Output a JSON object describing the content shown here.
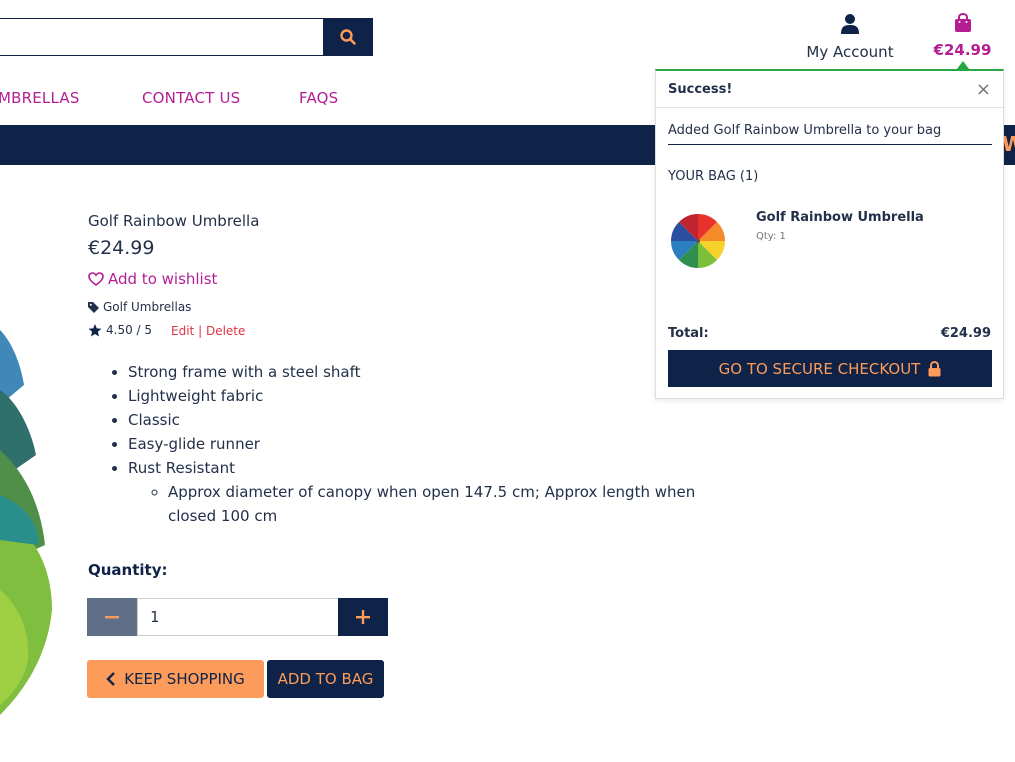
{
  "header": {
    "account_label": "My Account",
    "bag_total": "€24.99"
  },
  "nav": {
    "items": [
      "MBRELLAS",
      "CONTACT US",
      "FAQS"
    ]
  },
  "banner": {
    "text": "WE"
  },
  "product": {
    "name": "Golf Rainbow Umbrella",
    "price": "€24.99",
    "wishlist_label": "Add to wishlist",
    "category": "Golf Umbrellas",
    "rating": "4.50 / 5",
    "edit_label": "Edit",
    "separator": "|",
    "delete_label": "Delete",
    "features": [
      "Strong frame with a steel shaft",
      "Lightweight fabric",
      "Classic",
      "Easy-glide runner",
      "Rust Resistant"
    ],
    "sub_feature": "Approx diameter of canopy when open 147.5 cm; Approx length when closed 100 cm"
  },
  "quantity": {
    "label": "Quantity:",
    "value": "1"
  },
  "buttons": {
    "keep_shopping": "KEEP SHOPPING",
    "add_to_bag": "ADD TO BAG"
  },
  "toast": {
    "title": "Success!",
    "close": "×",
    "message": "Added Golf Rainbow Umbrella to your bag",
    "bag_label": "YOUR BAG (1)",
    "item_name": "Golf Rainbow Umbrella",
    "item_qty": "Qty: 1",
    "total_label": "Total:",
    "total_value": "€24.99",
    "checkout_label": "GO TO SECURE CHECKOUT"
  },
  "colors": {
    "navy": "#0e2347",
    "magenta": "#b31f93",
    "orange": "#fd9b5a",
    "success_green": "#28a745"
  },
  "icons": [
    "search-icon",
    "user-icon",
    "shopping-bag-icon",
    "heart-icon",
    "tag-icon",
    "star-icon",
    "minus-icon",
    "plus-icon",
    "chevron-left-icon",
    "lock-icon",
    "close-icon"
  ]
}
